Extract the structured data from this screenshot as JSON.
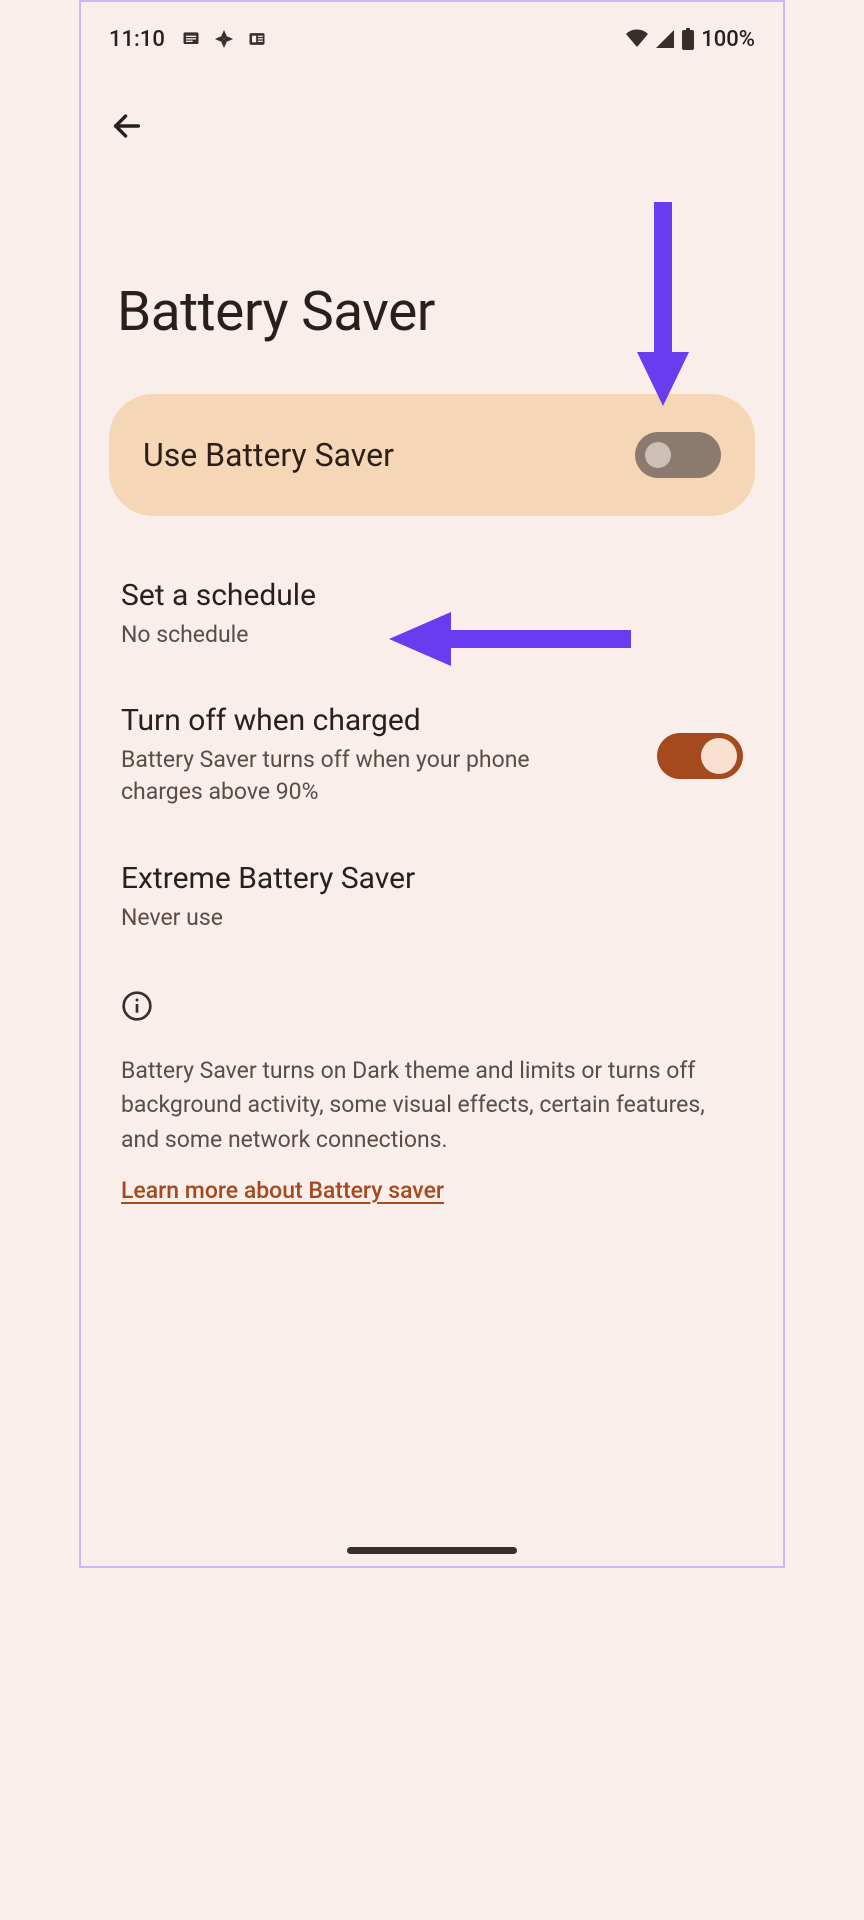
{
  "status": {
    "time": "11:10",
    "battery_text": "100%"
  },
  "header": {
    "title": "Battery Saver"
  },
  "main_toggle": {
    "label": "Use Battery Saver",
    "enabled": false
  },
  "settings": {
    "schedule": {
      "title": "Set a schedule",
      "subtitle": "No schedule"
    },
    "turn_off_charged": {
      "title": "Turn off when charged",
      "subtitle": "Battery Saver turns off when your phone charges above 90%",
      "enabled": true
    },
    "extreme": {
      "title": "Extreme Battery Saver",
      "subtitle": "Never use"
    }
  },
  "info": {
    "text": "Battery Saver turns on Dark theme and limits or turns off background activity, some visual effects, certain features, and some network connections.",
    "link": "Learn more about Battery saver"
  },
  "colors": {
    "annotation_arrow": "#6a3cf0",
    "accent_link": "#a54a1f"
  }
}
